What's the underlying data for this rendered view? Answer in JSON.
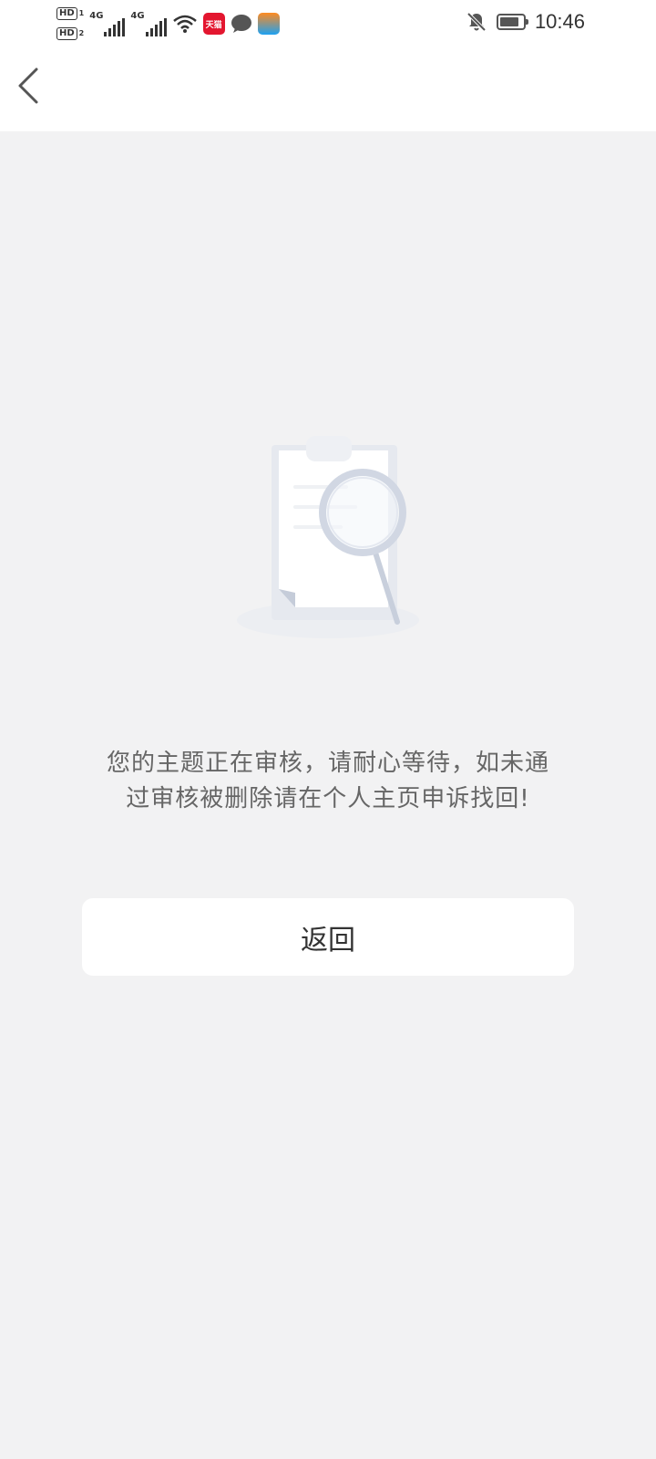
{
  "status_bar": {
    "sim1_label": "HD",
    "sim1_index": "1",
    "sim2_label": "HD",
    "sim2_index": "2",
    "network1": "4G",
    "network2": "4G",
    "tmall_icon_text": "天猫",
    "time": "10:46",
    "icons": [
      "signal-icon",
      "signal-icon",
      "wifi-icon",
      "tmall-app-icon",
      "message-icon",
      "app-icon",
      "notifications-muted-icon",
      "battery-icon"
    ]
  },
  "header": {
    "back_icon": "chevron-left-icon"
  },
  "empty_state": {
    "illustration": "clipboard-magnifier-icon",
    "message": "您的主题正在审核，请耐心等待，如未通过审核被删除请在个人主页申诉找回!"
  },
  "actions": {
    "return_label": "返回"
  },
  "colors": {
    "page_background": "#f2f2f3",
    "header_background": "#ffffff",
    "text_secondary": "#666666",
    "text_primary": "#333333"
  }
}
